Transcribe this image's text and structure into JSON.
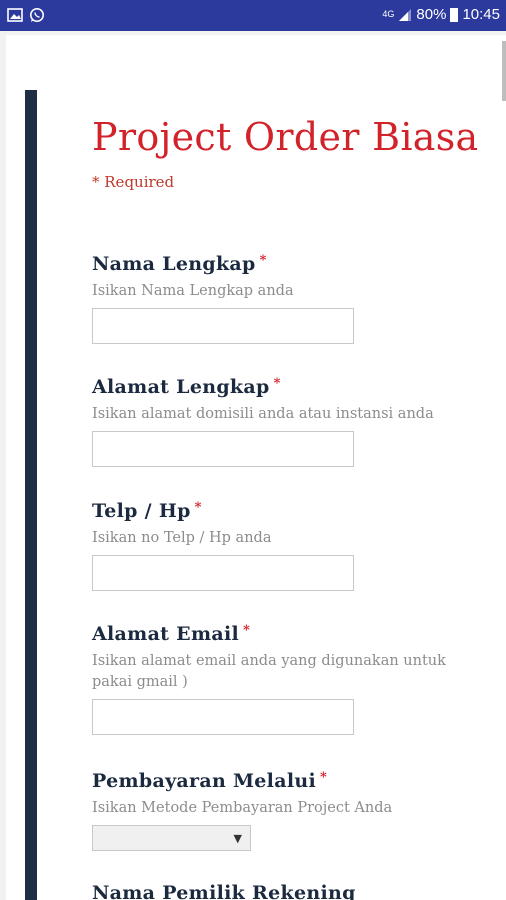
{
  "status_bar": {
    "left_icons": [
      "gallery-icon",
      "whatsapp-icon"
    ],
    "network": "4G",
    "battery": "80%",
    "time": "10:45"
  },
  "form": {
    "title": "Project Order Biasa",
    "required_note": "* Required",
    "questions": [
      {
        "title": "Nama Lengkap",
        "required": "*",
        "help": "Isikan Nama Lengkap anda"
      },
      {
        "title": "Alamat Lengkap",
        "required": "*",
        "help": "Isikan alamat domisili anda atau instansi anda"
      },
      {
        "title": "Telp / Hp",
        "required": "*",
        "help": "Isikan no Telp / Hp anda"
      },
      {
        "title": "Alamat Email",
        "required": "*",
        "help": "Isikan alamat email anda yang digunakan untuk",
        "help_line2": "pakai gmail )"
      },
      {
        "title": "Pembayaran Melalui",
        "required": "*",
        "help": "Isikan Metode Pembayaran Project Anda",
        "select_arrow": "▼"
      },
      {
        "title": "Nama Pemilik Rekening"
      }
    ]
  },
  "colors": {
    "status_bar": "#2c3a9e",
    "title": "#d2232a",
    "question_title": "#1b2a3f",
    "accent_bar": "#1e2e44"
  }
}
